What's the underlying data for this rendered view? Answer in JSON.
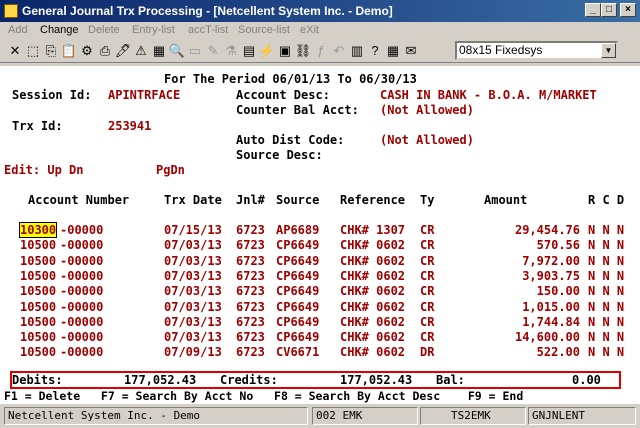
{
  "window": {
    "title": "General Journal Trx Processing - [Netcellent System Inc. - Demo]"
  },
  "menu": [
    "Add",
    "Change",
    "Delete",
    "Entry-list",
    "accT-list",
    "Source-list",
    "eXit"
  ],
  "toolbar": {
    "font_select": "08x15 Fixedsys"
  },
  "header": {
    "period": "For The Period 06/01/13 To 06/30/13",
    "session_label": "Session Id:",
    "session_value": "APINTRFACE",
    "acct_desc_label": "Account Desc:",
    "acct_desc_value": "CASH IN BANK - B.O.A. M/MARKET",
    "counter_label": "Counter Bal Acct:",
    "counter_value": "(Not Allowed)",
    "trx_label": "Trx Id:",
    "trx_value": "253941",
    "auto_dist_label": "Auto Dist Code:",
    "auto_dist_value": "(Not Allowed)",
    "source_desc_label": "Source Desc:",
    "edit_hint": "Edit: Up Dn",
    "pgdn": "PgDn"
  },
  "columns": {
    "account": "Account Number",
    "trx_date": "Trx Date",
    "jnl": "Jnl#",
    "source": "Source",
    "reference": "Reference",
    "ty": "Ty",
    "amount": "Amount",
    "rcd": "R C D"
  },
  "rows": [
    {
      "acct_a": "10300",
      "acct_b": "-00000",
      "date": "07/15/13",
      "jnl": "6723",
      "source": "AP6689",
      "ref": "CHK# 1307",
      "ty": "CR",
      "amount": "29,454.76",
      "flags": "N N N"
    },
    {
      "acct_a": "10500",
      "acct_b": "-00000",
      "date": "07/03/13",
      "jnl": "6723",
      "source": "CP6649",
      "ref": "CHK# 0602",
      "ty": "CR",
      "amount": "570.56",
      "flags": "N N N"
    },
    {
      "acct_a": "10500",
      "acct_b": "-00000",
      "date": "07/03/13",
      "jnl": "6723",
      "source": "CP6649",
      "ref": "CHK# 0602",
      "ty": "CR",
      "amount": "7,972.00",
      "flags": "N N N"
    },
    {
      "acct_a": "10500",
      "acct_b": "-00000",
      "date": "07/03/13",
      "jnl": "6723",
      "source": "CP6649",
      "ref": "CHK# 0602",
      "ty": "CR",
      "amount": "3,903.75",
      "flags": "N N N"
    },
    {
      "acct_a": "10500",
      "acct_b": "-00000",
      "date": "07/03/13",
      "jnl": "6723",
      "source": "CP6649",
      "ref": "CHK# 0602",
      "ty": "CR",
      "amount": "150.00",
      "flags": "N N N"
    },
    {
      "acct_a": "10500",
      "acct_b": "-00000",
      "date": "07/03/13",
      "jnl": "6723",
      "source": "CP6649",
      "ref": "CHK# 0602",
      "ty": "CR",
      "amount": "1,015.00",
      "flags": "N N N"
    },
    {
      "acct_a": "10500",
      "acct_b": "-00000",
      "date": "07/03/13",
      "jnl": "6723",
      "source": "CP6649",
      "ref": "CHK# 0602",
      "ty": "CR",
      "amount": "1,744.84",
      "flags": "N N N"
    },
    {
      "acct_a": "10500",
      "acct_b": "-00000",
      "date": "07/03/13",
      "jnl": "6723",
      "source": "CP6649",
      "ref": "CHK# 0602",
      "ty": "CR",
      "amount": "14,600.00",
      "flags": "N N N"
    },
    {
      "acct_a": "10500",
      "acct_b": "-00000",
      "date": "07/09/13",
      "jnl": "6723",
      "source": "CV6671",
      "ref": "CHK# 0602",
      "ty": "DR",
      "amount": "522.00",
      "flags": "N N N"
    }
  ],
  "totals": {
    "debits_label": "Debits:",
    "debits_value": "177,052.43",
    "credits_label": "Credits:",
    "credits_value": "177,052.43",
    "bal_label": "Bal:",
    "bal_value": "0.00"
  },
  "fkeys": "F1 = Delete   F7 = Search By Acct No   F8 = Search By Acct Desc    F9 = End",
  "status": {
    "company": "Netcellent System Inc. - Demo",
    "code": "002 EMK",
    "station": "TS2EMK",
    "program": "GNJNLENT"
  }
}
